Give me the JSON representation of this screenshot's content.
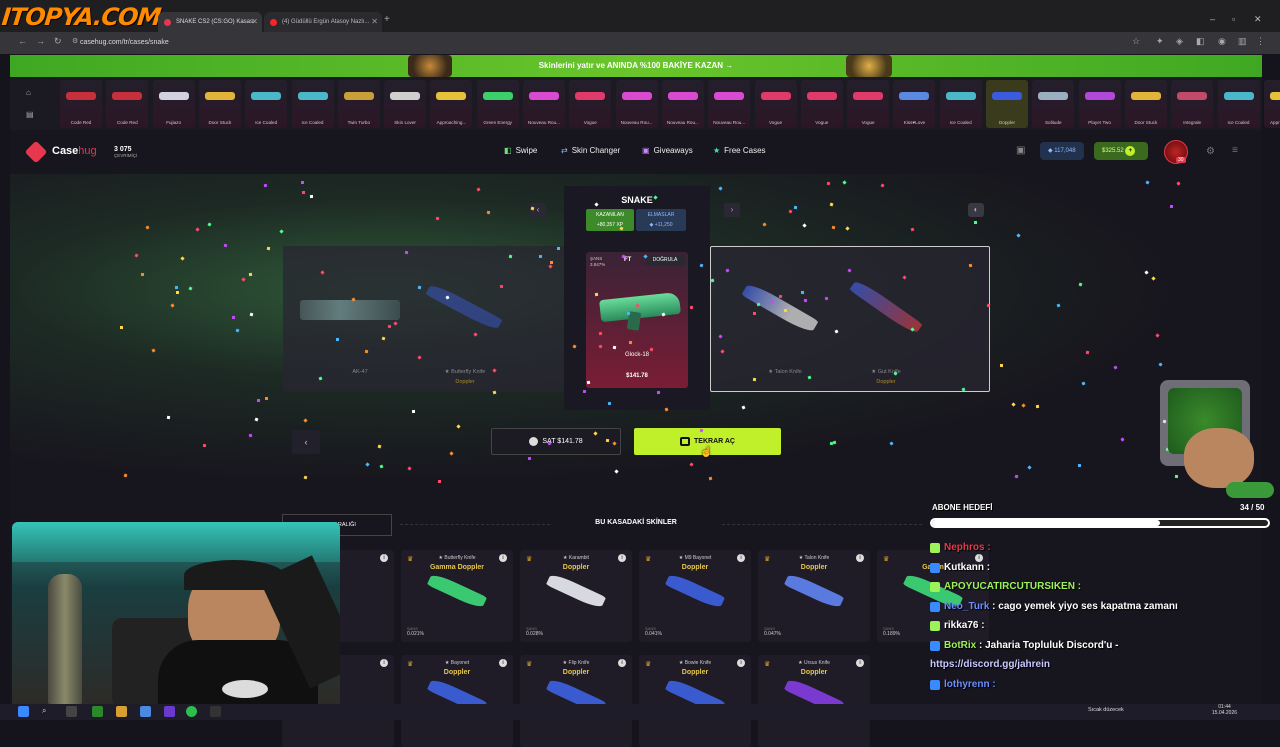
{
  "browser": {
    "logo": "ITOPYA.COM",
    "tabs": [
      {
        "label": "SNAKE CS2 (CS:GO) Kasası",
        "active": true
      },
      {
        "label": "(4) Güdüllü Ergün Atasoy Nazlı...",
        "active": false
      }
    ],
    "url": "casehug.com/tr/cases/snake"
  },
  "site": {
    "promo": "Skinlerini yatır ve ANINDA %100 BAKİYE KAZAN →",
    "logo_main": "Case",
    "logo_sub": "hug",
    "online_count": "3 075",
    "online_label": "ÇEVRİMİÇİ",
    "nav": [
      "Swipe",
      "Skin Changer",
      "Giveaways",
      "Free Cases"
    ],
    "balance_gems": "117,048",
    "balance_money": "$325.52",
    "level": "30"
  },
  "strip_items": [
    {
      "name": "Code Red",
      "color": "#c5303a"
    },
    {
      "name": "Code Red",
      "color": "#c5303a"
    },
    {
      "name": "Fujiazo",
      "color": "#d1d1e0"
    },
    {
      "name": "Door Stuck",
      "color": "#e2b53a"
    },
    {
      "name": "Ice Coaled",
      "color": "#4ab8c8"
    },
    {
      "name": "Ice Coaled",
      "color": "#4ab8c8"
    },
    {
      "name": "Twin Turbo",
      "color": "#c8a03a"
    },
    {
      "name": "Skin Lover",
      "color": "#cfcfcf"
    },
    {
      "name": "Approaching...",
      "color": "#e6c23a"
    },
    {
      "name": "Green Energy",
      "color": "#3bd06a"
    },
    {
      "name": "Nouveau Rou...",
      "color": "#d84ad0"
    },
    {
      "name": "Vogue",
      "color": "#e03a6a"
    },
    {
      "name": "Nouveau Rou...",
      "color": "#d84ad0"
    },
    {
      "name": "Nouveau Rou...",
      "color": "#d84ad0"
    },
    {
      "name": "Nouveau Rou...",
      "color": "#d84ad0"
    },
    {
      "name": "Vogue",
      "color": "#e03a6a"
    },
    {
      "name": "Vogue",
      "color": "#e03a6a"
    },
    {
      "name": "Vogue",
      "color": "#e03a6a"
    },
    {
      "name": "Kiss♥Love",
      "color": "#5a8ae0"
    },
    {
      "name": "Ice Coaled",
      "color": "#4ab8c8"
    },
    {
      "name": "Doppler",
      "color": "#3a5ae0",
      "highlight": true
    },
    {
      "name": "Solitude",
      "color": "#9ab0c0"
    },
    {
      "name": "Player Two",
      "color": "#b048d8"
    },
    {
      "name": "Door Stuck",
      "color": "#e2b53a"
    },
    {
      "name": "Integrale",
      "color": "#c04a6a"
    },
    {
      "name": "Ice Coaled",
      "color": "#4ab8c8"
    },
    {
      "name": "Approaching...",
      "color": "#e6c23a"
    }
  ],
  "case": {
    "title": "SNAKE",
    "win_label": "KAZANILAN",
    "win_value": "+80,357 XP",
    "dia_label": "ELMASLAR",
    "dia_value": "+11,250",
    "chance_label": "ŞANS",
    "chance_value": "3.847%",
    "wear": "FT",
    "verify": "DOĞRULA",
    "item_name": "Glock-18",
    "item_price": "$141.78",
    "slots": [
      {
        "name": "AK-47",
        "color": "#6e8a8a"
      },
      {
        "name": "★ Butterfly Knife",
        "sub": "Doppler",
        "color": "#3a5ad0"
      },
      {
        "name": "★ Talon Knife",
        "sub": "",
        "color": "#3a5ad0"
      },
      {
        "name": "★ Gut Knife",
        "sub": "Doppler",
        "color": "#c03a3a"
      }
    ],
    "sell_label": "SAT $141.78",
    "again_label": "TEKRAR AÇ"
  },
  "skins_section": {
    "title": "BU KASADAKİ SKİNLER",
    "range_tab": "ŞANS ARALIĞI",
    "row1": [
      {
        "name": "★ Butterfly Knife",
        "finish": "Gamma Doppler",
        "chance": "0.021%",
        "color": "#3ac870"
      },
      {
        "name": "★ Karambit",
        "finish": "Doppler",
        "chance": "0.028%",
        "color": "#d8d8e0"
      },
      {
        "name": "★ M9 Bayonet",
        "finish": "Doppler",
        "chance": "0.041%",
        "color": "#3a5ad0"
      },
      {
        "name": "★ Talon Knife",
        "finish": "Doppler",
        "chance": "0.047%",
        "color": "#5a7ae0"
      },
      {
        "name": "",
        "finish": "Gamm",
        "chance": "0.189%",
        "color": "#3ac870"
      }
    ],
    "row2": [
      {
        "name": "★ Bayonet",
        "finish": "Doppler",
        "color": "#3a5ad0"
      },
      {
        "name": "★ Flip Knife",
        "finish": "Doppler",
        "color": "#3a5ad0"
      },
      {
        "name": "★ Bowie Knife",
        "finish": "Doppler",
        "color": "#3a5ad0"
      },
      {
        "name": "★ Ursus Knife",
        "finish": "Doppler",
        "color": "#7a3ad0"
      }
    ],
    "chance_label": "ŞANS"
  },
  "overlay": {
    "goal_label": "ABONE HEDEFİ",
    "goal_count": "34 / 50",
    "goal_progress": 0.68,
    "chat": [
      {
        "user": "Nephros :",
        "msg": "",
        "color": "#e2394f"
      },
      {
        "user": "Kutkann :",
        "msg": "",
        "color": "#ffffff"
      },
      {
        "user": "APOYUCATIRCUTURSIKEN :",
        "msg": "",
        "color": "#9df25a"
      },
      {
        "user": "Neo_Turk",
        "msg": ": cago yemek yiyo ses kapatma zamanı",
        "color": "#6b8dff"
      },
      {
        "user": "rikka76 :",
        "msg": "",
        "color": "#ffffff"
      },
      {
        "user": "BotRix",
        "msg": ": Jaharia Topluluk Discord'u -",
        "color": "#9df25a"
      },
      {
        "user": "",
        "msg": "https://discord.gg/jahrein",
        "color": "#ffffff"
      },
      {
        "user": "lothyrenn :",
        "msg": "",
        "color": "#6b8dff"
      }
    ]
  },
  "taskbar": {
    "notice": "Sıcak düzecek",
    "time": "01:44",
    "date": "15.04.2026"
  }
}
